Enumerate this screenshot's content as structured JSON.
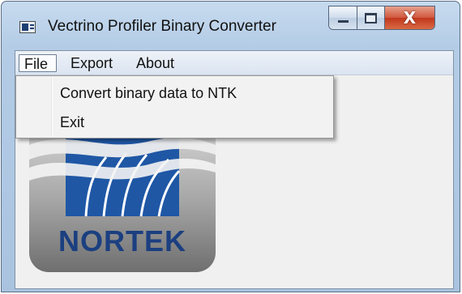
{
  "window": {
    "title": "Vectrino Profiler Binary Converter",
    "controls": {
      "minimize_icon": "minimize-icon",
      "maximize_icon": "maximize-icon",
      "close_icon": "close-icon",
      "close_glyph": "X"
    },
    "accent_color": "#c1371c",
    "frame_color": "#b4cce6"
  },
  "menubar": {
    "items": [
      {
        "label": "File",
        "state": "open"
      },
      {
        "label": "Export"
      },
      {
        "label": "About"
      }
    ]
  },
  "file_menu": {
    "items": [
      {
        "label": "Convert binary data to NTK"
      },
      {
        "label": "Exit"
      }
    ]
  },
  "logo": {
    "text": "NORTEK",
    "brand_color": "#1b3f80"
  }
}
